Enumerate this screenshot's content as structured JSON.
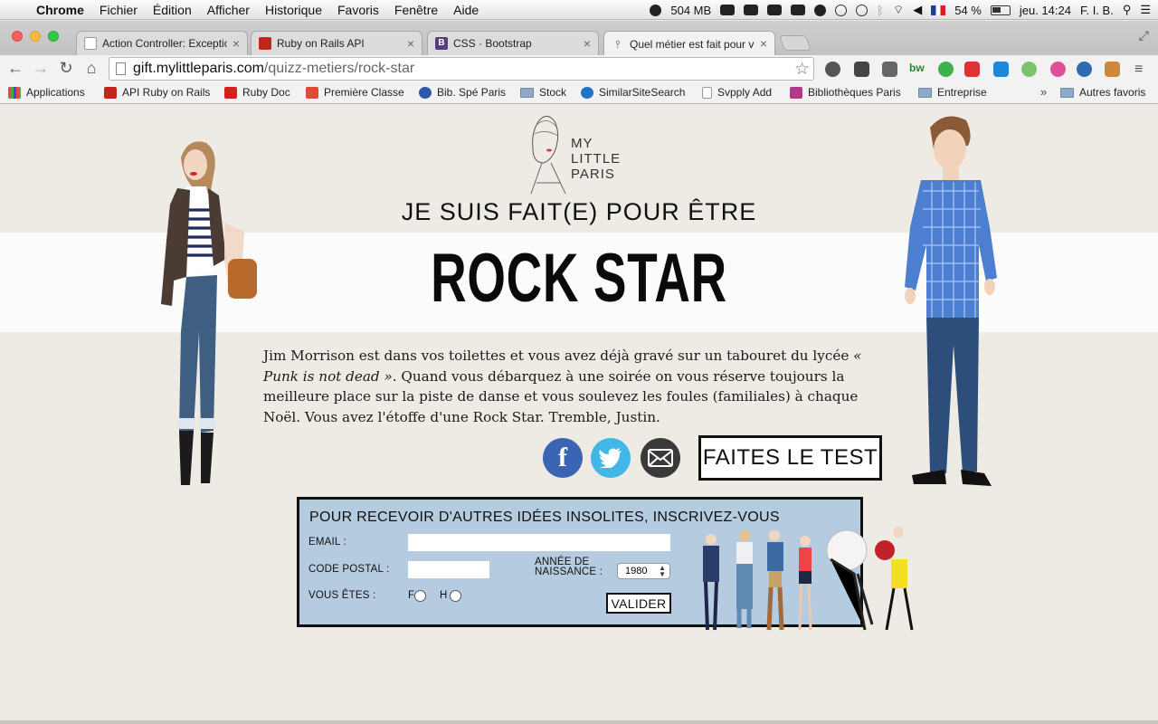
{
  "menubar": {
    "app": "Chrome",
    "items": [
      "Fichier",
      "Édition",
      "Afficher",
      "Historique",
      "Favoris",
      "Fenêtre",
      "Aide"
    ],
    "memory": "504 MB",
    "battery": "54 %",
    "clock": "jeu. 14:24",
    "user": "F. I. B."
  },
  "tabs": [
    {
      "label": "Action Controller: Exceptio",
      "favicon_color": "#ffffff",
      "close": "×"
    },
    {
      "label": "Ruby on Rails API",
      "favicon_color": "#c0271b",
      "close": "×"
    },
    {
      "label": "CSS · Bootstrap",
      "favicon_color": "#563d7c",
      "close": "×"
    },
    {
      "label": "Quel métier est fait pour vo",
      "favicon_color": "#ffffff",
      "close": "×"
    }
  ],
  "toolbar": {
    "back": "←",
    "forward": "→",
    "reload": "↻",
    "home": "⌂",
    "url_host": "gift.mylittleparis.com",
    "url_path": "/quizz-metiers/rock-star",
    "star": "☆"
  },
  "bookmarks": [
    {
      "label": "Applications",
      "icon": "apps-grid-icon"
    },
    {
      "label": "API Ruby on Rails",
      "icon": "rails-icon"
    },
    {
      "label": "Ruby Doc",
      "icon": "ruby-icon"
    },
    {
      "label": "Première Classe",
      "icon": "google-plus-icon"
    },
    {
      "label": "Bib. Spé Paris",
      "icon": "globe-icon"
    },
    {
      "label": "Stock",
      "icon": "folder-icon"
    },
    {
      "label": "SimilarSiteSearch",
      "icon": "similar-icon"
    },
    {
      "label": "Svpply Add",
      "icon": "page-icon"
    },
    {
      "label": "Bibliothèques Paris",
      "icon": "library-icon"
    },
    {
      "label": "Entreprise",
      "icon": "folder-icon"
    },
    {
      "label": "Autres favoris",
      "icon": "folder-icon"
    }
  ],
  "bookmarks_more": "»",
  "page": {
    "logo": {
      "line1": "MY",
      "line2": "LITTLE",
      "line3": "PARIS"
    },
    "subtitle": "JE SUIS FAIT(E) POUR ÊTRE",
    "title": "ROCK STAR",
    "description": {
      "part1": "Jim Morrison est dans vos toilettes et vous avez déjà gravé sur un tabouret du lycée ",
      "italic": "« Punk is not dead »",
      "part2": ". Quand vous débarquez à une soirée on vous réserve toujours la meilleure place sur la piste de danse et vous soulevez les foules (familiales) à chaque Noël. Vous avez l'étoffe d'une Rock Star. Tremble, Justin."
    },
    "share": {
      "facebook": "f",
      "twitter": "🐦",
      "email": "✉"
    },
    "test_button": "FAITES LE TEST",
    "signup": {
      "title": "POUR RECEVOIR D'AUTRES IDÉES INSOLITES, INSCRIVEZ-VOUS",
      "email_label": "EMAIL :",
      "postal_label": "CODE POSTAL :",
      "birth_label_1": "ANNÉE DE",
      "birth_label_2": "NAISSANCE :",
      "birth_value": "1980",
      "gender_label": "VOUS ÊTES :",
      "female": "F",
      "male": "H",
      "submit": "VALIDER"
    }
  },
  "colors": {
    "page_bg": "#eeebe5",
    "signup_bg": "#b5cce0",
    "facebook": "#3b64b4",
    "twitter": "#43b6e8"
  }
}
